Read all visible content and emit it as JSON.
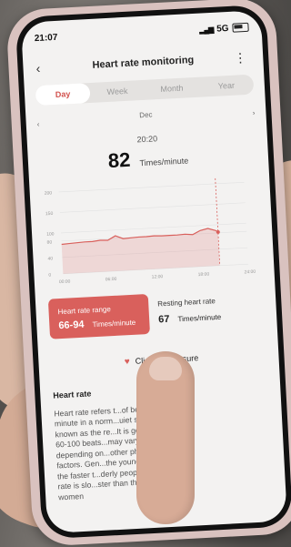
{
  "status": {
    "time": "21:07",
    "network": "5G"
  },
  "header": {
    "title": "Heart rate monitoring",
    "back_icon": "back-arrow-icon",
    "menu_icon": "more-vertical-icon"
  },
  "tabs": [
    {
      "label": "Day",
      "active": true
    },
    {
      "label": "Week",
      "active": false
    },
    {
      "label": "Month",
      "active": false
    },
    {
      "label": "Year",
      "active": false
    }
  ],
  "date_nav": {
    "month": "Dec",
    "prev_icon": "chevron-left-icon",
    "next_icon": "chevron-right-icon"
  },
  "current": {
    "time": "20:20",
    "value": "82",
    "unit": "Times/minute"
  },
  "chart_data": {
    "type": "area",
    "y_ticks": [
      "200",
      "150",
      "100",
      "80",
      "40",
      "0"
    ],
    "ylim": [
      0,
      200
    ],
    "x_ticks": [
      "00:00",
      "06:00",
      "12:00",
      "18:00",
      "24:00"
    ],
    "x": [
      0,
      1,
      2,
      3,
      4,
      5,
      6,
      7,
      8,
      9,
      10,
      11,
      12,
      13,
      14,
      15,
      16,
      17,
      18,
      19,
      20,
      20.3
    ],
    "values": [
      72,
      73,
      74,
      75,
      75,
      77,
      76,
      86,
      78,
      79,
      80,
      80,
      81,
      80,
      80,
      80,
      81,
      79,
      88,
      92,
      86,
      82
    ],
    "color": "#d9605c"
  },
  "summary": {
    "range_label": "Heart rate range",
    "range_value": "66-94",
    "range_unit": "Times/minute",
    "resting_label": "Resting heart rate",
    "resting_value": "67",
    "resting_unit": "Times/minute"
  },
  "measure": {
    "label": "Click on Measure",
    "icon": "heart-pulse-icon"
  },
  "info": {
    "title": "Heart rate",
    "lines": [
      "Heart rate refers t...of beats per",
      "minute in a norm...uiet state, also",
      "known as the re...It is generally",
      "60-100 beats...may vary",
      "depending on...other physiological",
      "factors. Gen...the younger the age,",
      "the faster t...derly people's heart",
      "rate is slo...ster than that of men of",
      "women"
    ]
  }
}
